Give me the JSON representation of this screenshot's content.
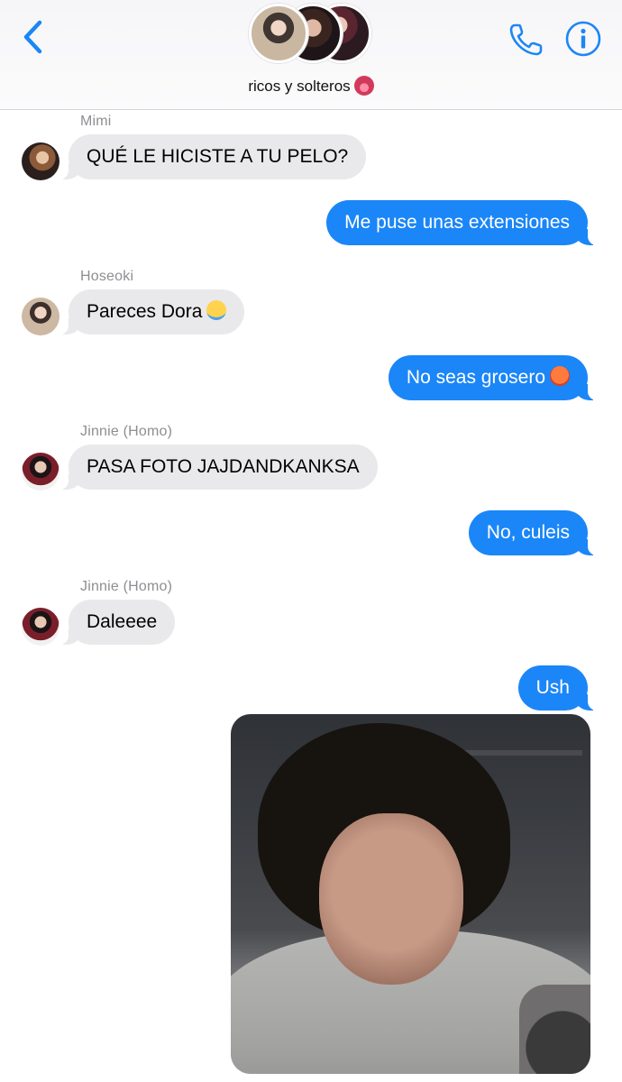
{
  "header": {
    "group_name": "ricos y solteros",
    "group_emoji_icon": "tongue-emoji-icon",
    "accent_color": "#1b86f7"
  },
  "messages": [
    {
      "sender": "Mimi",
      "text": "QUÉ LE HICISTE A TU PELO?",
      "direction": "in"
    },
    {
      "text": "Me puse unas extensiones",
      "direction": "out"
    },
    {
      "sender": "Hoseoki",
      "text": "Pareces Dora",
      "emoji_icon": "loudly-crying-face-icon",
      "direction": "in"
    },
    {
      "text": "No seas grosero",
      "emoji_icon": "angry-face-icon",
      "direction": "out"
    },
    {
      "sender": "Jinnie (Homo)",
      "text": "PASA FOTO JAJDANDKANKSA",
      "direction": "in"
    },
    {
      "text": "No, culeis",
      "direction": "out"
    },
    {
      "sender": "Jinnie (Homo)",
      "text": "Daleeee",
      "direction": "in"
    },
    {
      "text": "Ush",
      "direction": "out"
    }
  ],
  "colors": {
    "incoming_bubble": "#e9e9eb",
    "outgoing_bubble": "#1b86f7",
    "sender_name": "#8e8e93"
  }
}
